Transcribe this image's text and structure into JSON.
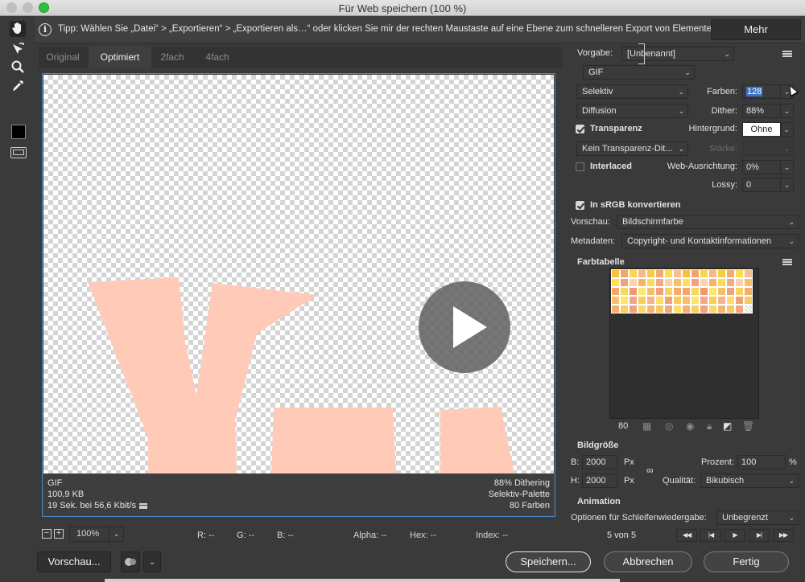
{
  "window": {
    "title": "Für Web speichern (100 %)"
  },
  "tip": {
    "text": "Tipp: Wählen Sie „Datei“ > „Exportieren“ > „Exportieren als…“ oder klicken Sie mir der rechten Maustaste auf eine Ebene zum schnelleren Export von Elementen",
    "more_label": "Mehr"
  },
  "tools": [
    {
      "name": "hand-tool",
      "icon": "hand-icon"
    },
    {
      "name": "slice-select-tool",
      "icon": "slice-select-icon"
    },
    {
      "name": "zoom-tool",
      "icon": "magnifier-icon"
    },
    {
      "name": "eyedropper-tool",
      "icon": "eyedropper-icon"
    }
  ],
  "tabs": [
    {
      "label": "Original",
      "active": false
    },
    {
      "label": "Optimiert",
      "active": true
    },
    {
      "label": "2fach",
      "active": false
    },
    {
      "label": "4fach",
      "active": false
    }
  ],
  "preview": {
    "shape_color": "#ffcbb8",
    "info": {
      "format": "GIF",
      "size": "100,9 KB",
      "time": "19 Sek. bei 56,6 Kbit/s",
      "dithering": "88% Dithering",
      "palette": "Selektiv-Palette",
      "colors": "80 Farben"
    }
  },
  "zoom": {
    "value": "100%",
    "r": "R: --",
    "g": "G: --",
    "b": "B: --",
    "alpha": "Alpha: --",
    "hex": "Hex: --",
    "index": "Index: --"
  },
  "buttons": {
    "preview": "Vorschau...",
    "save": "Speichern...",
    "cancel": "Abbrechen",
    "done": "Fertig"
  },
  "settings": {
    "preset_label": "Vorgabe:",
    "preset_value": "[Unbenannt]",
    "format": "GIF",
    "reduction": "Selektiv",
    "colors_label": "Farben:",
    "colors_value": "128",
    "dither_algo": "Diffusion",
    "dither_label": "Dither:",
    "dither_value": "88%",
    "transparency_label": "Transparenz",
    "transparency_checked": true,
    "matte_label": "Hintergrund:",
    "matte_value": "Ohne",
    "transp_dither": "Kein Transparenz-Dit...",
    "amount_label": "Stärke:",
    "interlaced_label": "Interlaced",
    "interlaced_checked": false,
    "websnap_label": "Web-Ausrichtung:",
    "websnap_value": "0%",
    "lossy_label": "Lossy:",
    "lossy_value": "0",
    "srgb_label": "In sRGB konvertieren",
    "srgb_checked": true,
    "preview_label": "Vorschau:",
    "preview_value": "Bildschirmfarbe",
    "metadata_label": "Metadaten:",
    "metadata_value": "Copyright- und Kontaktinformationen"
  },
  "color_table": {
    "title": "Farbtabelle",
    "count": "80",
    "colors": [
      "#f7c23a",
      "#f2a56c",
      "#f9d64c",
      "#f5b98a",
      "#f8cc3e",
      "#f3ab72",
      "#fadf50",
      "#f6c190",
      "#f7c23a",
      "#f2a56c",
      "#f9d64c",
      "#f5b98a",
      "#f8cc3e",
      "#f3ab72",
      "#fadf50",
      "#f6c190",
      "#fbe05a",
      "#f4a07a",
      "#fcd2b0",
      "#f7b468",
      "#fbd95a",
      "#f5a884",
      "#fbd0ab",
      "#f8bd6c",
      "#fbe05a",
      "#f4a07a",
      "#fcd2b0",
      "#f7b468",
      "#fbd95a",
      "#f5a884",
      "#fbd0ab",
      "#f8bd6c",
      "#f3a868",
      "#f9d65e",
      "#f1986e",
      "#fbe772",
      "#f6c068",
      "#f1a17e",
      "#fad45e",
      "#f4ad6c",
      "#f3a868",
      "#f9d65e",
      "#f1986e",
      "#fbe772",
      "#f6c068",
      "#f1a17e",
      "#fad45e",
      "#f4ad6c",
      "#f8c06a",
      "#fde46a",
      "#f1a886",
      "#f9ce58",
      "#f6b48e",
      "#fddc68",
      "#f2a278",
      "#f8ca60",
      "#f8c06a",
      "#fde46a",
      "#f1a886",
      "#f9ce58",
      "#f6b48e",
      "#fddc68",
      "#f2a278",
      "#f8ca60",
      "#f5b070",
      "#f7d062",
      "#f3a07c",
      "#fbd86a",
      "#f6b776",
      "#f8c85e",
      "#f2a682",
      "#fadf66",
      "#f5b070",
      "#f7d062",
      "#f3a07c",
      "#fbd86a",
      "#f6b776",
      "#f8c85e",
      "#f2a682",
      "transparent"
    ]
  },
  "image_size": {
    "title": "Bildgröße",
    "w_label": "B:",
    "w_value": "2000",
    "w_unit": "Px",
    "h_label": "H:",
    "h_value": "2000",
    "h_unit": "Px",
    "percent_label": "Prozent:",
    "percent_value": "100",
    "percent_unit": "%",
    "quality_label": "Qualität:",
    "quality_value": "Bikubisch"
  },
  "animation": {
    "title": "Animation",
    "loop_label": "Optionen für Schleifenwiedergabe:",
    "loop_value": "Unbegrenzt",
    "frame_counter": "5 von 5"
  }
}
